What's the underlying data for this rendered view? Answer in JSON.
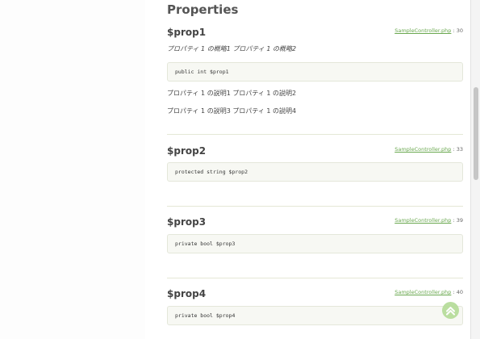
{
  "section": {
    "title": "Properties"
  },
  "properties": [
    {
      "name": "$prop1",
      "source_file": "SampleController.php",
      "source_line": " : 30",
      "summary": "プロパティ 1 の概略1 プロパティ 1 の概略2",
      "signature": "public int $prop1",
      "descriptions": [
        "プロパティ 1 の説明1 プロパティ 1 の説明2",
        "プロパティ 1 の説明3 プロパティ 1 の説明4"
      ]
    },
    {
      "name": "$prop2",
      "source_file": "SampleController.php",
      "source_line": " : 33",
      "signature": "protected string $prop2"
    },
    {
      "name": "$prop3",
      "source_file": "SampleController.php",
      "source_line": " : 39",
      "signature": "private bool $prop3"
    },
    {
      "name": "$prop4",
      "source_file": "SampleController.php",
      "source_line": " : 40",
      "signature": "private bool $prop4"
    }
  ],
  "scroll_to_top": {
    "icon": "chevron-up-icon"
  }
}
